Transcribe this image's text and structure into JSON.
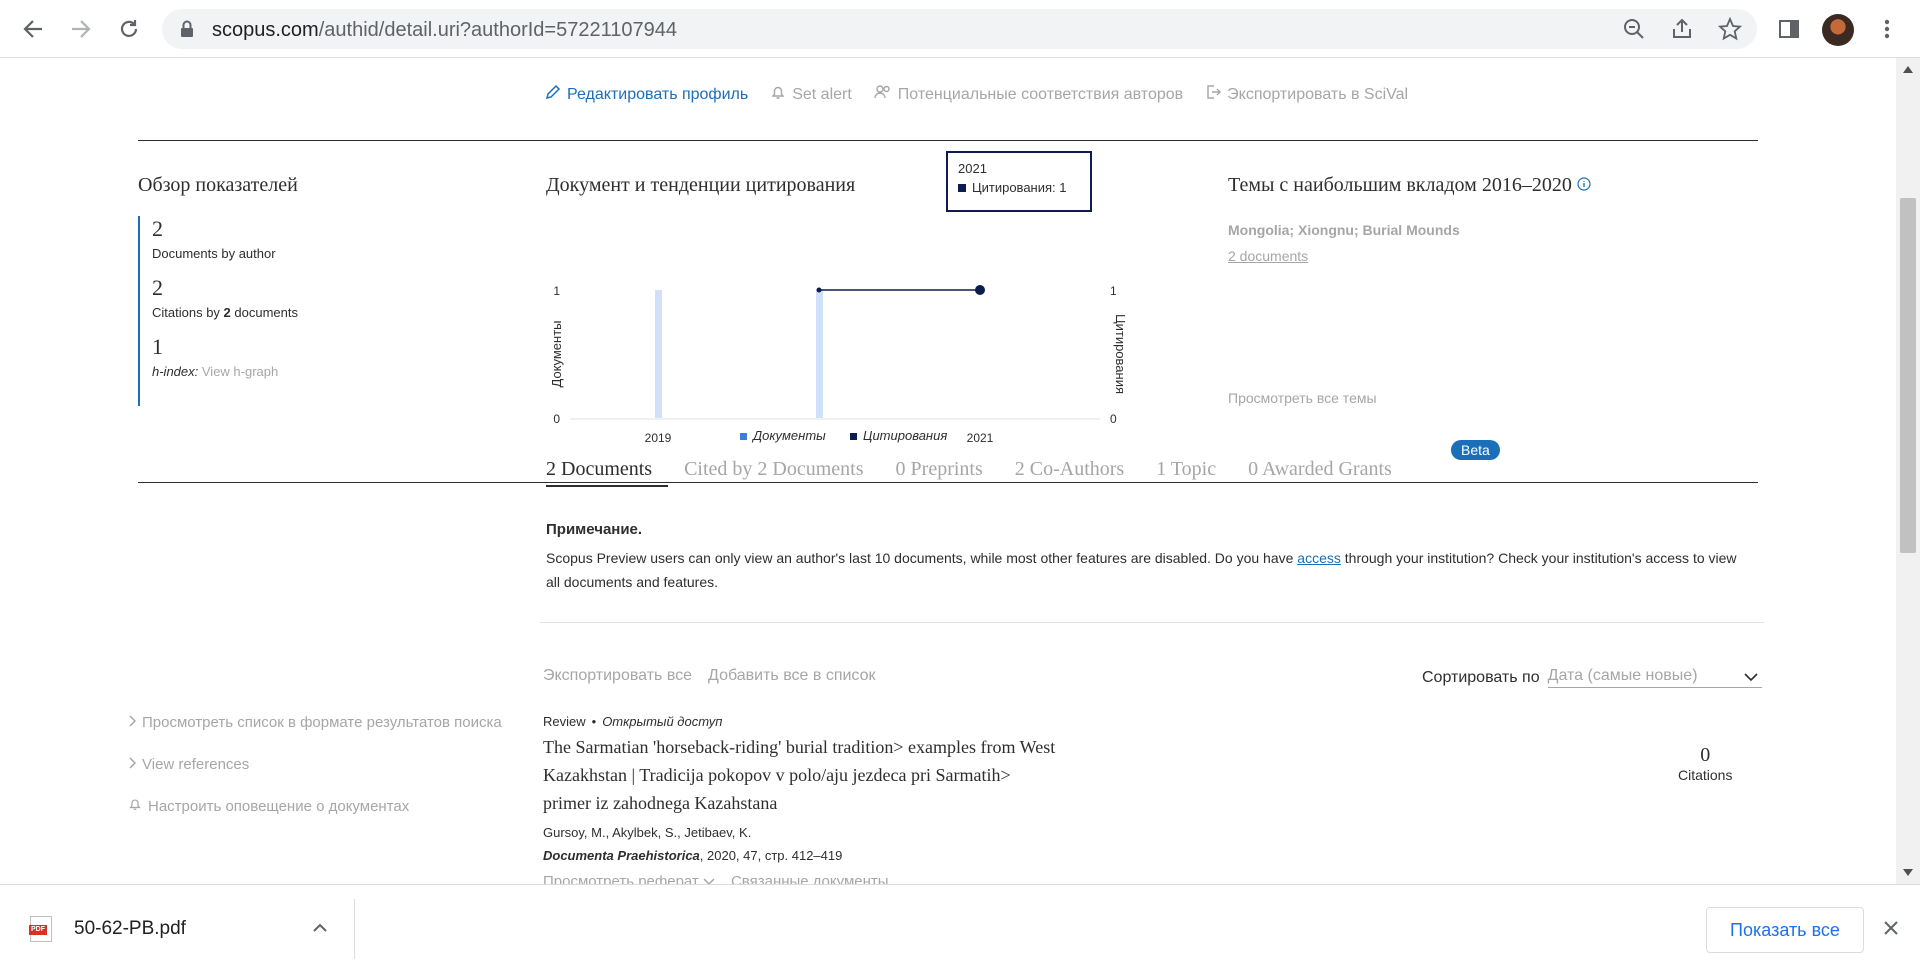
{
  "browser": {
    "url_host": "scopus.com",
    "url_path": "/authid/detail.uri?authorId=57221107944"
  },
  "profile_actions": [
    {
      "label": "Редактировать профиль",
      "icon": "pencil-icon"
    },
    {
      "label": "Set alert",
      "icon": "bell-icon"
    },
    {
      "label": "Потенциальные соответствия авторов",
      "icon": "users-icon"
    },
    {
      "label": "Экспортировать в SciVal",
      "icon": "export-icon"
    }
  ],
  "metrics": {
    "title": "Обзор показателей",
    "docs_num": "2",
    "docs_label": "Documents by author",
    "cites_num": "2",
    "cites_label_prefix": "Citations by ",
    "cites_label_bold": "2",
    "cites_label_suffix": " documents",
    "h_num": "1",
    "h_label": "h-index:",
    "h_link": "View h-graph"
  },
  "chart": {
    "title": "Документ и тенденции цитирования",
    "tooltip_year": "2021",
    "tooltip_text": "Цитирования: 1",
    "legend_docs": "Документы",
    "legend_cites": "Цитирования"
  },
  "chart_data": {
    "type": "bar",
    "categories": [
      "2019",
      "2020",
      "2021"
    ],
    "x_tick_labels": [
      "2019",
      "2021"
    ],
    "series": [
      {
        "name": "Документы",
        "type": "bar",
        "values": [
          1,
          1,
          0
        ]
      },
      {
        "name": "Цитирования",
        "type": "line",
        "values": [
          0,
          1,
          1
        ]
      }
    ],
    "xlabel": "",
    "ylabel": "Документы",
    "y2label": "Цитирования",
    "ylim": [
      0,
      1
    ],
    "y2lim": [
      0,
      1
    ],
    "colors": {
      "docs": "#cfe0f8",
      "cites": "#0c1c4f"
    }
  },
  "topics": {
    "title": "Темы с наибольшим вкладом 2016–2020",
    "topic_name": "Mongolia; Xiongnu; Burial Mounds",
    "topic_docs": "2 documents",
    "view_all": "Просмотреть все темы"
  },
  "tabs": [
    {
      "label": "2 Documents",
      "active": true
    },
    {
      "label": "Cited by 2 Documents",
      "active": false
    },
    {
      "label": "0 Preprints",
      "active": false
    },
    {
      "label": "2 Co-Authors",
      "active": false
    },
    {
      "label": "1 Topic",
      "active": false
    },
    {
      "label": "0 Awarded Grants",
      "active": false
    }
  ],
  "beta_badge": "Beta",
  "note": {
    "title": "Примечание.",
    "text_before": "Scopus Preview users can only view an author's last 10 documents, while most other features are disabled. Do you have ",
    "link": "access",
    "text_after": " through your institution? Check your institution's access to view all documents and features."
  },
  "doc_actions": {
    "export_all": "Экспортировать все",
    "add_all": "Добавить все в список",
    "sort_label": "Сортировать по",
    "sort_value": "Дата (самые новые)"
  },
  "side_links": [
    "Просмотреть список в формате результатов поиска",
    "View references",
    "Настроить оповещение о документах"
  ],
  "document": {
    "type": "Review",
    "access": "Открытый доступ",
    "title": "The Sarmatian 'horseback-riding' burial tradition> examples from West Kazakhstan | Tradicija pokopov v polo/aju jezdeca pri Sarmatih> primer iz zahodnega Kazahstana",
    "authors": "Gursoy, M., Akylbek, S., Jetibaev, K.",
    "source_journal": "Documenta Praehistorica",
    "source_details": ", 2020, 47, стр. 412–419",
    "abstract_link": "Просмотреть реферат",
    "related_link": "Связанные документы",
    "citations_num": "0",
    "citations_label": "Citations"
  },
  "downloads": {
    "file_name": "50-62-PB.pdf",
    "pdf_tag": "PDF",
    "show_all": "Показать все"
  }
}
